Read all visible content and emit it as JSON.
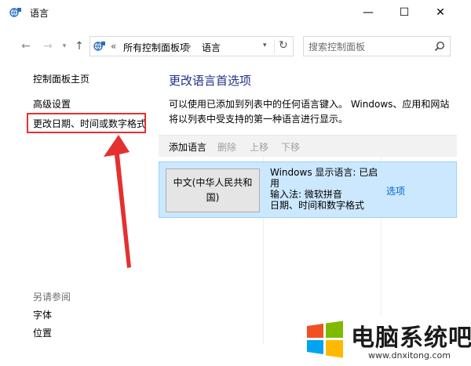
{
  "window": {
    "title": "语言",
    "minimize_glyph": "—",
    "maximize_glyph": "☐",
    "close_glyph": "✕"
  },
  "nav": {
    "back_glyph": "←",
    "forward_glyph": "→",
    "recent_glyph": "▾",
    "up_glyph": "↑"
  },
  "address": {
    "chevron": "«",
    "separator": "›",
    "segments": [
      "所有控制面板项",
      "语言"
    ],
    "dropdown_glyph": "▾",
    "refresh_glyph": "↻"
  },
  "search": {
    "placeholder": "搜索控制面板"
  },
  "sidebar": {
    "home": "控制面板主页",
    "items": [
      "高级设置",
      "更改日期、时间或数字格式"
    ],
    "see_also_heading": "另请参阅",
    "see_also": [
      "字体",
      "位置"
    ]
  },
  "main": {
    "title": "更改语言首选项",
    "description": "可以使用已添加到列表中的任何语言键入。 Windows、应用和网站将以列表中受支持的第一种语言进行显示。"
  },
  "toolbar": {
    "add": "添加语言",
    "remove": "删除",
    "move_up": "上移",
    "move_down": "下移"
  },
  "languages": [
    {
      "name": "中文(中华人民共和国)",
      "display_language": "Windows 显示语言: 已启用",
      "input_method": "输入法: 微软拼音",
      "formats": "日期、时间和数字格式",
      "options_link": "选项"
    }
  ],
  "watermark": {
    "name": "电脑系统吧",
    "url": "www.dnxitong.com"
  },
  "colors": {
    "accent_title": "#1e3287",
    "selected_row_bg": "#cce8ff",
    "selected_row_border": "#99d1ff",
    "highlight_box": "#e53030",
    "arrow": "#e53030",
    "link": "#0066cc",
    "windows_logo": [
      "#f25022",
      "#7fba00",
      "#00a4ef",
      "#ffb900"
    ]
  }
}
